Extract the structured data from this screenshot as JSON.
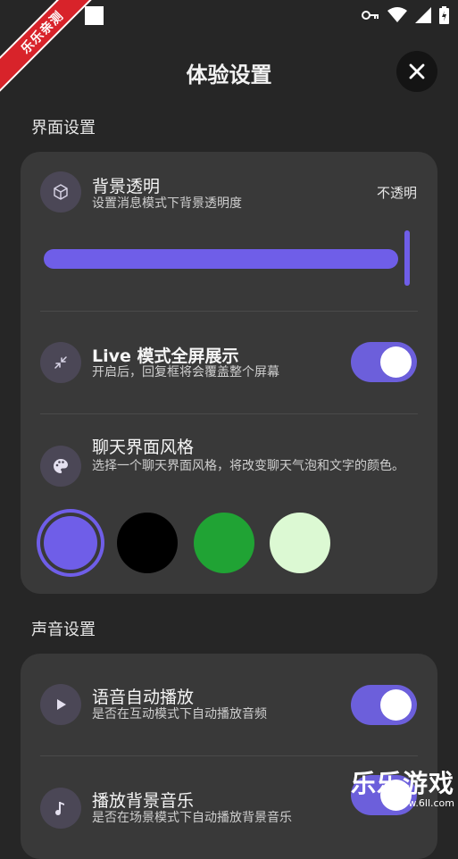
{
  "status_bar": {
    "ribbon_text": "乐乐亲测",
    "icons": [
      "square-icon",
      "key-icon",
      "wifi-icon",
      "signal-icon",
      "battery-icon"
    ]
  },
  "header": {
    "title": "体验设置",
    "close_icon": "close-icon"
  },
  "sections": {
    "interface": {
      "title": "界面设置",
      "bg_transparency": {
        "title": "背景透明",
        "subtitle": "设置消息模式下背景透明度",
        "value_label": "不透明",
        "slider_value": 1.0
      },
      "live_fullscreen": {
        "title": "Live 模式全屏展示",
        "subtitle": "开启后，回复框将会覆盖整个屏幕",
        "enabled": true
      },
      "chat_style": {
        "title": "聊天界面风格",
        "subtitle": "选择一个聊天界面风格，将改变聊天气泡和文字的颜色。",
        "swatches": [
          {
            "color": "#6f5ee8",
            "selected": true
          },
          {
            "color": "#000000",
            "selected": false
          },
          {
            "color": "#20a334",
            "selected": false
          },
          {
            "color": "#dcf9d3",
            "selected": false
          }
        ]
      }
    },
    "sound": {
      "title": "声音设置",
      "voice_autoplay": {
        "title": "语音自动播放",
        "subtitle": "是否在互动模式下自动播放音频",
        "enabled": true
      },
      "bg_music": {
        "title": "播放背景音乐",
        "subtitle": "是否在场景模式下自动播放背景音乐",
        "enabled": true
      }
    }
  },
  "watermark": {
    "main": "乐乐游戏",
    "url": "www.6ll.com"
  },
  "colors": {
    "accent": "#6f5ee8",
    "card": "#393939",
    "background": "#262626"
  }
}
